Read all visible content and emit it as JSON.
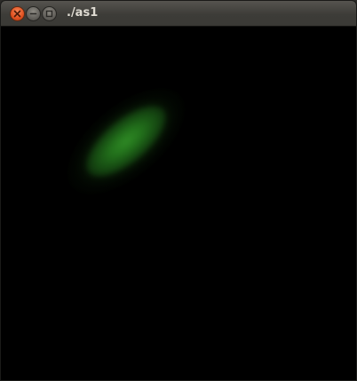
{
  "window": {
    "title": "./as1",
    "buttons": {
      "close": "close-icon",
      "minimize": "minimize-icon",
      "maximize": "maximize-icon"
    }
  },
  "canvas": {
    "background_color": "#000000",
    "blob_color": "#2f8a25"
  }
}
